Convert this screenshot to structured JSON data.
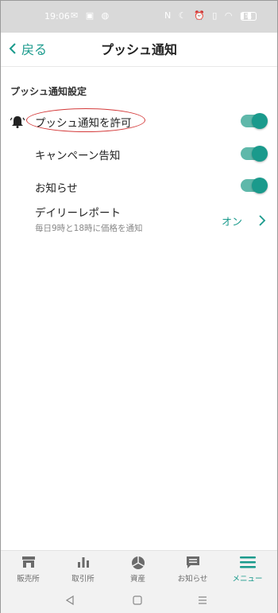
{
  "status": {
    "time": "19:06",
    "left_icons": "✉ ▣ ◍",
    "right_icons": "N ☾ ⏰ ▯ ◠ ▮▮",
    "battery": "51"
  },
  "header": {
    "back_label": "戻る",
    "title": "プッシュ通知"
  },
  "section": {
    "title": "プッシュ通知設定"
  },
  "settings": [
    {
      "label": "プッシュ通知を許可",
      "on": true
    },
    {
      "label": "キャンペーン告知",
      "on": true
    },
    {
      "label": "お知らせ",
      "on": true
    }
  ],
  "daily": {
    "label": "デイリーレポート",
    "sub": "毎日9時と18時に価格を通知",
    "value": "オン"
  },
  "tabs": [
    {
      "label": "販売所",
      "icon": "store-icon"
    },
    {
      "label": "取引所",
      "icon": "bar-chart-icon"
    },
    {
      "label": "資産",
      "icon": "pie-chart-icon"
    },
    {
      "label": "お知らせ",
      "icon": "message-icon"
    },
    {
      "label": "メニュー",
      "icon": "menu-icon",
      "active": true
    }
  ],
  "colors": {
    "accent": "#1a9a8c",
    "toggle_track": "#5fb8aa",
    "highlight": "#d43a3a"
  }
}
